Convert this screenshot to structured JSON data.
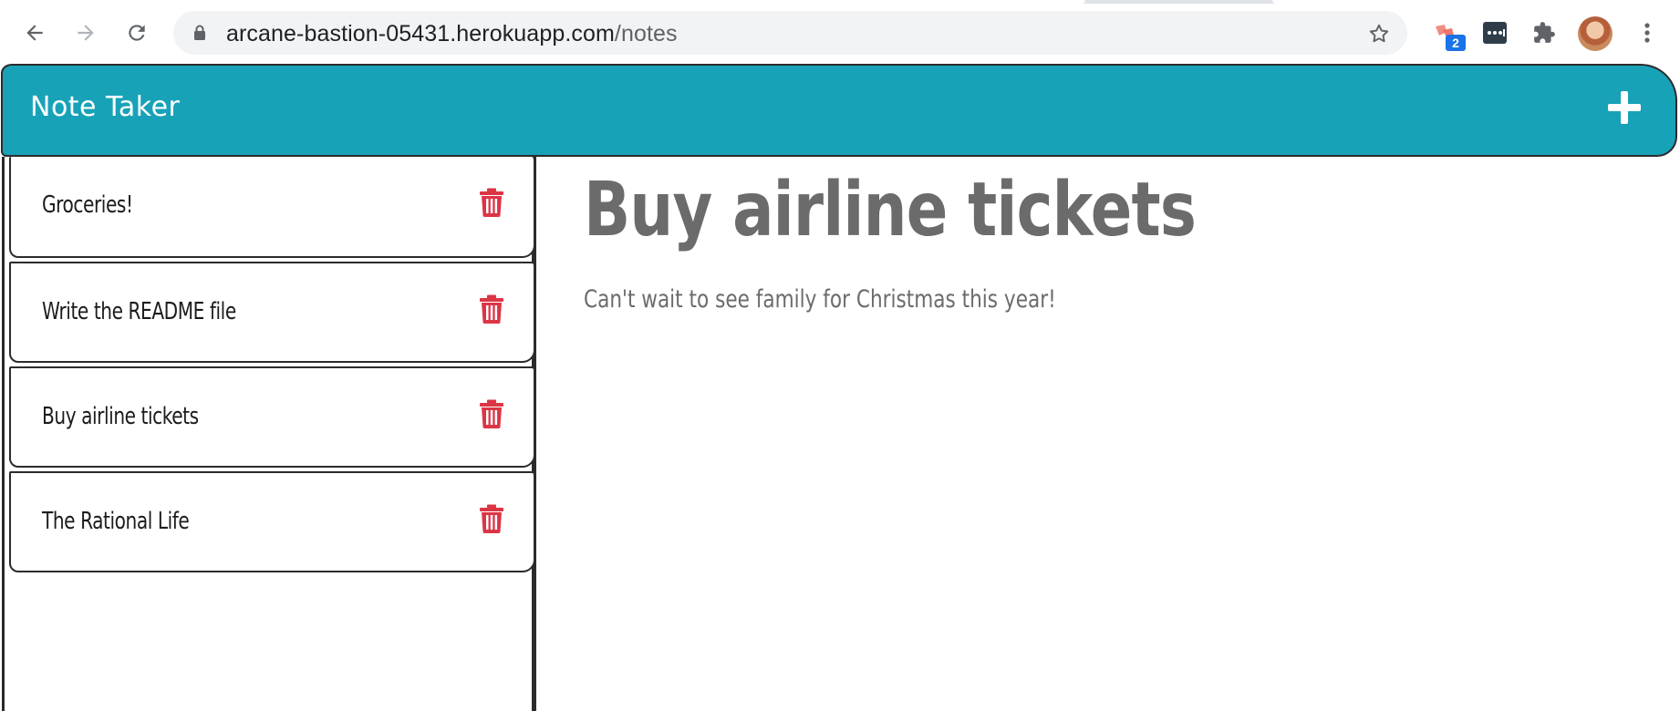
{
  "browser": {
    "url_host": "arcane-bastion-05431.herokuapp.com",
    "url_path": "/notes",
    "extension_badge": "2",
    "icons": {
      "back": "arrow-left-icon",
      "forward": "arrow-right-icon",
      "reload": "reload-icon",
      "lock": "lock-icon",
      "bookmark": "star-icon",
      "extension1": "puzzle-piece-icon",
      "extension2": "password-manager-icon",
      "extensions": "extensions-icon",
      "menu": "kebab-menu-icon"
    }
  },
  "app": {
    "title": "Note Taker",
    "add_icon": "plus-icon",
    "accent_color": "#18a2b8",
    "trash_color": "#dc3545"
  },
  "notes": [
    {
      "title": "Groceries!"
    },
    {
      "title": "Write the README file"
    },
    {
      "title": "Buy airline tickets"
    },
    {
      "title": "The Rational Life"
    }
  ],
  "active_note": {
    "title": "Buy airline tickets",
    "text": "Can't wait to see family for Christmas this year!"
  }
}
